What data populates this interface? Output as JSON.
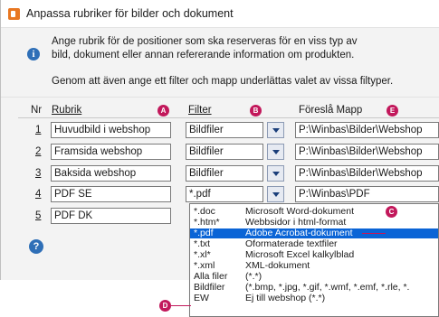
{
  "window": {
    "title": "Anpassa rubriker för bilder och dokument"
  },
  "info": {
    "line1": "Ange rubrik för de positioner som ska reserveras för en viss typ av",
    "line2": "bild, dokument eller annan refererande information om produkten.",
    "line3": "Genom att även ange ett filter och mapp underlättas valet av vissa filtyper."
  },
  "columns": {
    "nr": "Nr",
    "rubrik": "Rubrik",
    "filter": "Filter",
    "mapp": "Föreslå Mapp"
  },
  "rows": [
    {
      "nr": "1",
      "rubrik": "Huvudbild i webshop",
      "filter": "Bildfiler",
      "mapp": "P:\\Winbas\\Bilder\\Webshop"
    },
    {
      "nr": "2",
      "rubrik": "Framsida webshop",
      "filter": "Bildfiler",
      "mapp": "P:\\Winbas\\Bilder\\Webshop"
    },
    {
      "nr": "3",
      "rubrik": "Baksida webshop",
      "filter": "Bildfiler",
      "mapp": "P:\\Winbas\\Bilder\\Webshop"
    },
    {
      "nr": "4",
      "rubrik": "PDF SE",
      "filter": "*.pdf",
      "mapp": "P:\\Winbas\\PDF"
    },
    {
      "nr": "5",
      "rubrik": "PDF DK",
      "filter": "",
      "mapp": ""
    }
  ],
  "badges": {
    "a": "A",
    "b": "B",
    "c": "C",
    "d": "D",
    "e": "E"
  },
  "help_icon": "?",
  "info_icon": "i",
  "dropdown": {
    "items": [
      {
        "ext": "*.doc",
        "desc": "Microsoft Word-dokument",
        "selected": false
      },
      {
        "ext": "*.htm*",
        "desc": "Webbsidor i html-format",
        "selected": false
      },
      {
        "ext": "*.pdf",
        "desc": "Adobe Acrobat-dokument",
        "selected": true
      },
      {
        "ext": "*.txt",
        "desc": "Oformaterade textfiler",
        "selected": false
      },
      {
        "ext": "*.xl*",
        "desc": "Microsoft Excel kalkylblad",
        "selected": false
      },
      {
        "ext": "*.xml",
        "desc": "XML-dokument",
        "selected": false
      },
      {
        "ext": "Alla filer",
        "desc": "(*.*)",
        "selected": false
      },
      {
        "ext": "Bildfiler",
        "desc": "(*.bmp, *.jpg, *.gif, *.wmf, *.emf, *.rle, *.",
        "selected": false
      },
      {
        "ext": "EW",
        "desc": "Ej till webshop (*.*)",
        "selected": false
      }
    ]
  },
  "colors": {
    "accent_badge": "#c2185b",
    "selection": "#0a64d6",
    "info_icon": "#2f6fb7"
  },
  "icons": {
    "app": "app-document-icon",
    "info": "info-icon",
    "help": "help-icon",
    "dropdown": "chevron-down-icon"
  }
}
